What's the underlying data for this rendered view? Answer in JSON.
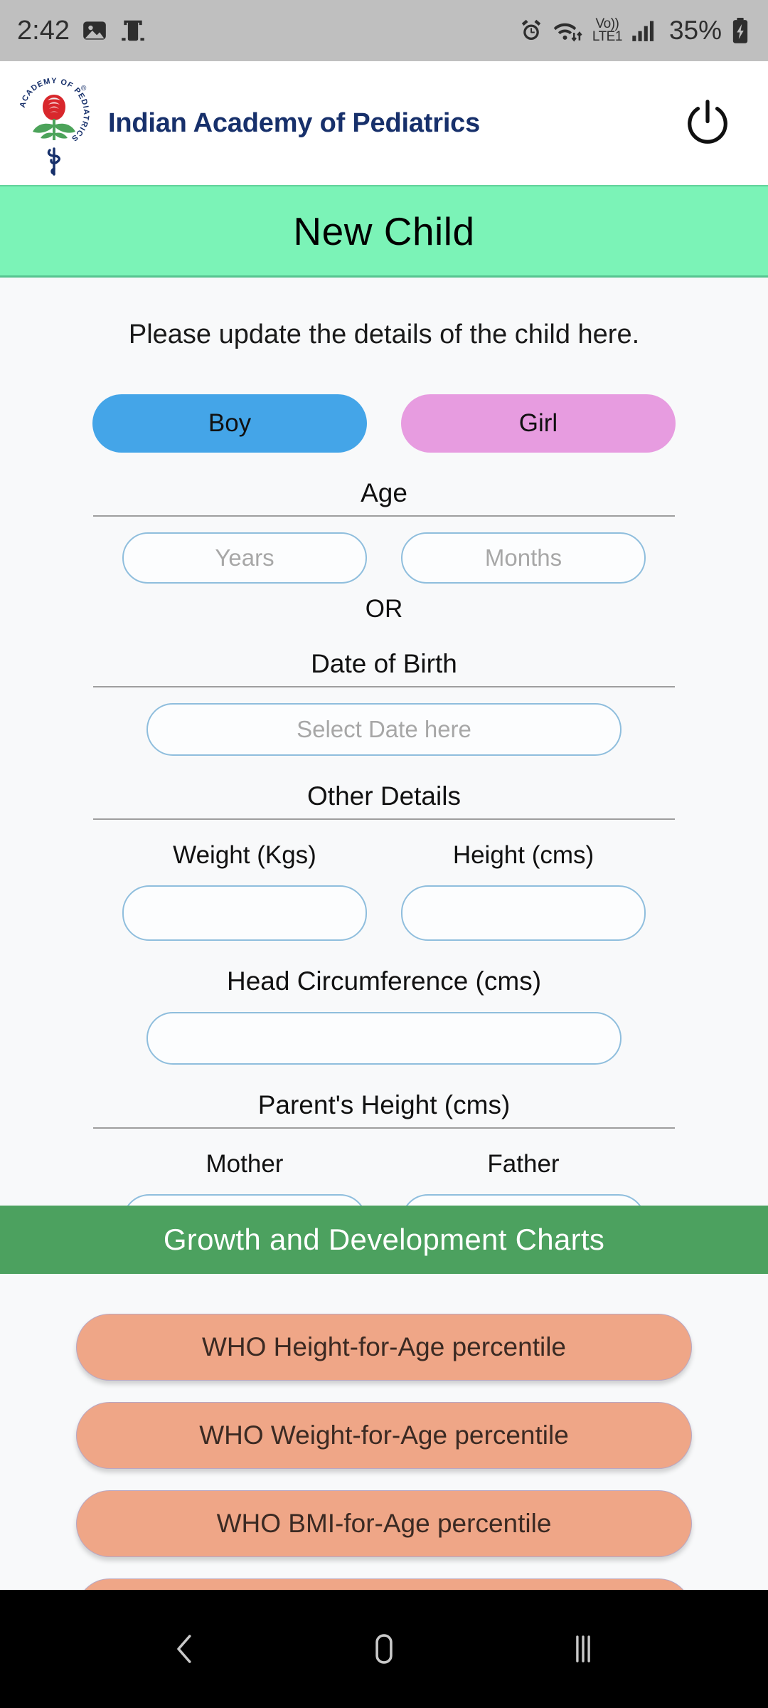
{
  "status_bar": {
    "time": "2:42",
    "left_icons": [
      "photo-icon",
      "screen-record-icon"
    ],
    "volte_top": "Vo))",
    "volte_bottom": "LTE1",
    "right_icons": [
      "alarm-icon",
      "wifi-icon",
      "volte-icon",
      "signal-bars-icon",
      "battery-charging-icon"
    ],
    "battery_percent": "35%"
  },
  "app_header": {
    "brand_title": "Indian Academy of Pediatrics",
    "logo_ring_text": "INDIAN ACADEMY OF PEDIATRICS",
    "logo_name": "iap-logo",
    "power_icon": "power-icon"
  },
  "page_banner": {
    "title": "New Child"
  },
  "form": {
    "intro": "Please update the details of the child here.",
    "gender": {
      "boy_label": "Boy",
      "girl_label": "Girl",
      "boy_color": "#44A5E8",
      "girl_color": "#E79CE0"
    },
    "age_section": {
      "label": "Age",
      "years_placeholder": "Years",
      "years_value": "",
      "months_placeholder": "Months",
      "months_value": ""
    },
    "or_text": "OR",
    "dob_section": {
      "label": "Date of Birth",
      "date_placeholder": "Select Date here",
      "date_value": ""
    },
    "other_details": {
      "label": "Other Details",
      "weight_label": "Weight (Kgs)",
      "weight_value": "",
      "height_label": "Height (cms)",
      "height_value": "",
      "head_circumference_label": "Head Circumference (cms)",
      "head_circumference_value": ""
    },
    "parents_height": {
      "label": "Parent's Height (cms)",
      "mother_label": "Mother",
      "mother_value": "",
      "father_label": "Father",
      "father_value": ""
    }
  },
  "charts_section": {
    "header": "Growth and Development Charts",
    "header_color": "#4CA15F",
    "button_color": "#EFA687",
    "buttons": [
      "WHO Height-for-Age percentile",
      "WHO Weight-for-Age percentile",
      "WHO BMI-for-Age percentile",
      ""
    ]
  },
  "nav_bar": {
    "back_icon": "back-chevron-icon",
    "home_icon": "home-icon",
    "recents_icon": "recents-icon"
  }
}
